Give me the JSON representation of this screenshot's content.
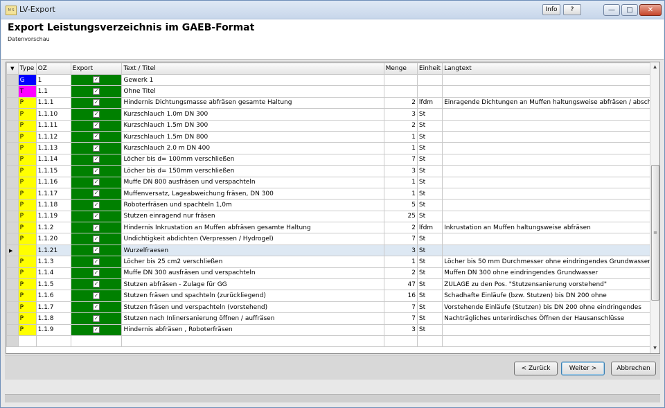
{
  "window": {
    "title": "LV-Export",
    "app_icon_text": "M S"
  },
  "toolbar": {
    "info_label": "Info",
    "help_label": "?"
  },
  "header": {
    "title": "Export Leistungsverzeichnis  im GAEB-Format",
    "subtitle": "Datenvorschau"
  },
  "colors": {
    "G": "#0000ff",
    "T": "#ff00ff",
    "P": "#ffff00",
    "export": "#008000"
  },
  "grid": {
    "columns": [
      "Type",
      "OZ",
      "Export",
      "Text / Titel",
      "Menge",
      "Einheit",
      "Langtext"
    ],
    "rows": [
      {
        "type": "G",
        "oz": "1",
        "text": "Gewerk 1",
        "menge": "",
        "einheit": "",
        "langtext": ""
      },
      {
        "type": "T",
        "oz": "1.1",
        "text": "Ohne Titel",
        "menge": "",
        "einheit": "",
        "langtext": ""
      },
      {
        "type": "P",
        "oz": "1.1.1",
        "text": "Hindernis Dichtungsmasse abfräsen gesamte Haltung",
        "menge": "2",
        "einheit": "lfdm",
        "langtext": "Einragende Dichtungen an Muffen haltungsweise abfräsen / absch..."
      },
      {
        "type": "P",
        "oz": "1.1.10",
        "text": "Kurzschlauch 1.0m  DN 300",
        "menge": "3",
        "einheit": "St",
        "langtext": ""
      },
      {
        "type": "P",
        "oz": "1.1.11",
        "text": "Kurzschlauch 1.5m  DN 300",
        "menge": "2",
        "einheit": "St",
        "langtext": ""
      },
      {
        "type": "P",
        "oz": "1.1.12",
        "text": "Kurzschlauch 1.5m  DN 800",
        "menge": "1",
        "einheit": "St",
        "langtext": ""
      },
      {
        "type": "P",
        "oz": "1.1.13",
        "text": "Kurzschlauch 2.0 m DN 400",
        "menge": "1",
        "einheit": "St",
        "langtext": ""
      },
      {
        "type": "P",
        "oz": "1.1.14",
        "text": "Löcher bis d= 100mm verschließen",
        "menge": "7",
        "einheit": "St",
        "langtext": ""
      },
      {
        "type": "P",
        "oz": "1.1.15",
        "text": "Löcher bis d= 150mm verschließen",
        "menge": "3",
        "einheit": "St",
        "langtext": ""
      },
      {
        "type": "P",
        "oz": "1.1.16",
        "text": "Muffe DN 800 ausfräsen und verspachteln",
        "menge": "1",
        "einheit": "St",
        "langtext": ""
      },
      {
        "type": "P",
        "oz": "1.1.17",
        "text": "Muffenversatz, Lageabweichung fräsen, DN 300",
        "menge": "1",
        "einheit": "St",
        "langtext": ""
      },
      {
        "type": "P",
        "oz": "1.1.18",
        "text": "Roboterfräsen und spachteln 1,0m",
        "menge": "5",
        "einheit": "St",
        "langtext": ""
      },
      {
        "type": "P",
        "oz": "1.1.19",
        "text": "Stutzen einragend  nur fräsen",
        "menge": "25",
        "einheit": "St",
        "langtext": ""
      },
      {
        "type": "P",
        "oz": "1.1.2",
        "text": "Hindernis Inkrustation an Muffen abfräsen gesamte Haltung",
        "menge": "2",
        "einheit": "lfdm",
        "langtext": "Inkrustation an Muffen haltungsweise abfräsen"
      },
      {
        "type": "P",
        "oz": "1.1.20",
        "text": "Undichtigkeit abdichten (Verpressen / Hydrogel)",
        "menge": "7",
        "einheit": "St",
        "langtext": ""
      },
      {
        "type": "",
        "oz": "1.1.21",
        "text": "Wurzelfraesen",
        "menge": "3",
        "einheit": "St",
        "langtext": ""
      },
      {
        "type": "P",
        "oz": "1.1.3",
        "text": "Löcher  bis  25 cm2 verschließen",
        "menge": "1",
        "einheit": "St",
        "langtext": "Löcher bis 50 mm Durchmesser ohne eindringendes Grundwasser"
      },
      {
        "type": "P",
        "oz": "1.1.4",
        "text": "Muffe DN 300 ausfräsen und verspachteln",
        "menge": "2",
        "einheit": "St",
        "langtext": "Muffen DN 300 ohne eindringendes Grundwasser"
      },
      {
        "type": "P",
        "oz": "1.1.5",
        "text": "Stutzen abfräsen - Zulage für GG",
        "menge": "47",
        "einheit": "St",
        "langtext": "ZULAGE zu den Pos. \"Stutzensanierung vorstehend\""
      },
      {
        "type": "P",
        "oz": "1.1.6",
        "text": "Stutzen fräsen und spachteln (zurückliegend)",
        "menge": "16",
        "einheit": "St",
        "langtext": "Schadhafte Einläufe (bzw. Stutzen) bis DN 200 ohne"
      },
      {
        "type": "P",
        "oz": "1.1.7",
        "text": "Stutzen fräsen und verspachteln (vorstehend)",
        "menge": "7",
        "einheit": "St",
        "langtext": "Vorstehende Einläufe (Stutzen) bis DN 200 ohne eindringendes"
      },
      {
        "type": "P",
        "oz": "1.1.8",
        "text": "Stutzen nach Inlinersanierung öffnen / auffräsen",
        "menge": "7",
        "einheit": "St",
        "langtext": "Nachträgliches unterirdisches Öffnen der Hausanschlüsse"
      },
      {
        "type": "P",
        "oz": "1.1.9",
        "text": "Hindernis abfräsen , Roboterfräsen",
        "menge": "3",
        "einheit": "St",
        "langtext": ""
      }
    ]
  },
  "buttons": {
    "back": "< Zurück",
    "next": "Weiter >",
    "cancel": "Abbrechen"
  }
}
